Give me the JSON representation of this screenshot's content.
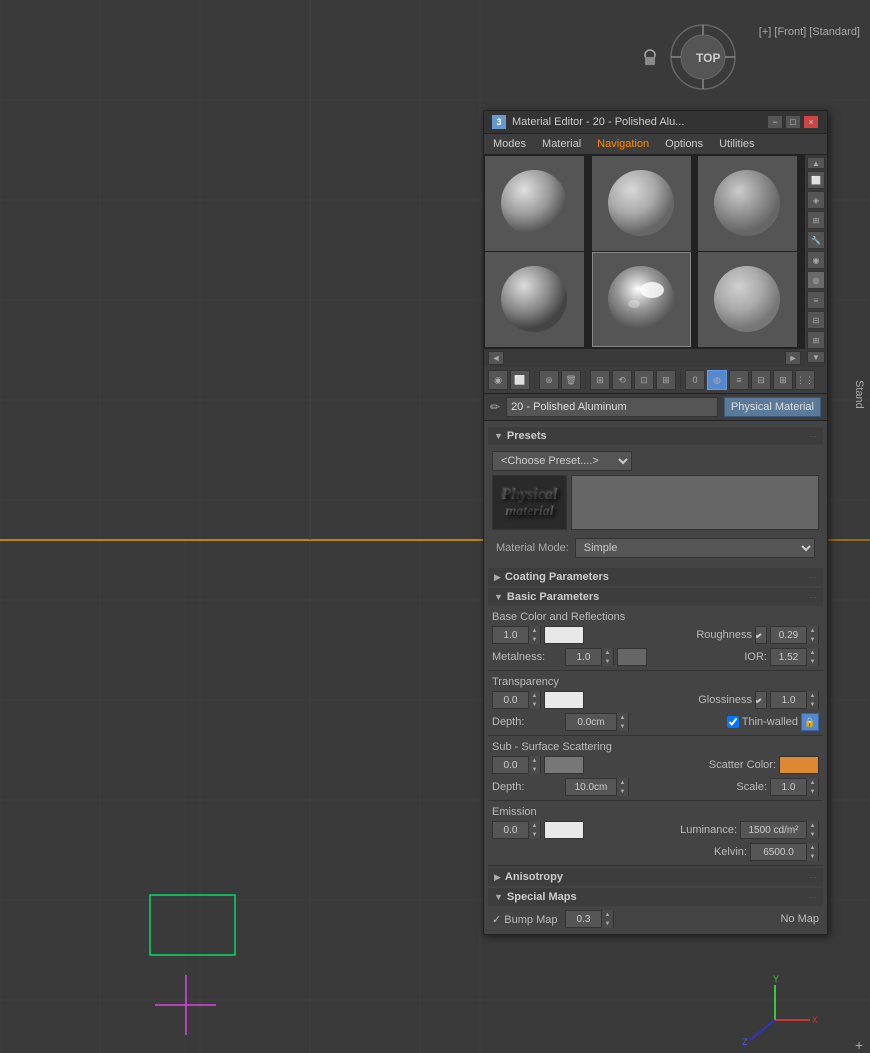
{
  "viewport": {
    "label": "[+] [Front] [Standard]",
    "stand_label": "Stand"
  },
  "material_editor": {
    "title": "Material Editor - 20 - Polished Alu...",
    "title_icon": "3",
    "min_btn": "−",
    "max_btn": "□",
    "close_btn": "×",
    "menu": {
      "modes": "Modes",
      "material": "Material",
      "navigation": "Navigation",
      "options": "Options",
      "utilities": "Utilities"
    },
    "material_name": "20 - Polished Aluminum",
    "material_type": "Physical Material",
    "nav_left": "◄",
    "nav_right": "►",
    "presets": {
      "section_title": "Presets",
      "dropdown_label": "<Choose Preset....>",
      "logo_line1": "Physical",
      "logo_line2": "material"
    },
    "material_mode": {
      "label": "Material Mode:",
      "value": "Simple"
    },
    "coating_params": {
      "section_title": "Coating Parameters"
    },
    "basic_params": {
      "section_title": "Basic Parameters",
      "subsection": "Base Color and Reflections",
      "value1": "1.0",
      "roughness_label": "Roughness",
      "roughness_value": "0.29",
      "metalness_label": "Metalness:",
      "metalness_value": "1.0",
      "ior_label": "IOR:",
      "ior_value": "1.52"
    },
    "transparency": {
      "section_title": "Transparency",
      "value": "0.0",
      "glossiness_label": "Glossiness",
      "glossiness_value": "1.0",
      "depth_label": "Depth:",
      "depth_value": "0.0cm",
      "thin_walled": "Thin-walled"
    },
    "subsurface": {
      "section_title": "Sub - Surface Scattering",
      "value": "0.0",
      "scatter_color_label": "Scatter Color:",
      "depth_label": "Depth:",
      "depth_value": "10.0cm",
      "scale_label": "Scale:",
      "scale_value": "1.0"
    },
    "emission": {
      "section_title": "Emission",
      "value": "0.0",
      "luminance_label": "Luminance:",
      "luminance_value": "1500 cd/m²",
      "kelvin_label": "Kelvin:",
      "kelvin_value": "6500.0"
    },
    "anisotropy": {
      "section_title": "Anisotropy"
    },
    "special_maps": {
      "section_title": "Special Maps",
      "bump_map_label": "✓ Bump Map",
      "bump_value": "0.3",
      "no_map": "No Map"
    }
  }
}
